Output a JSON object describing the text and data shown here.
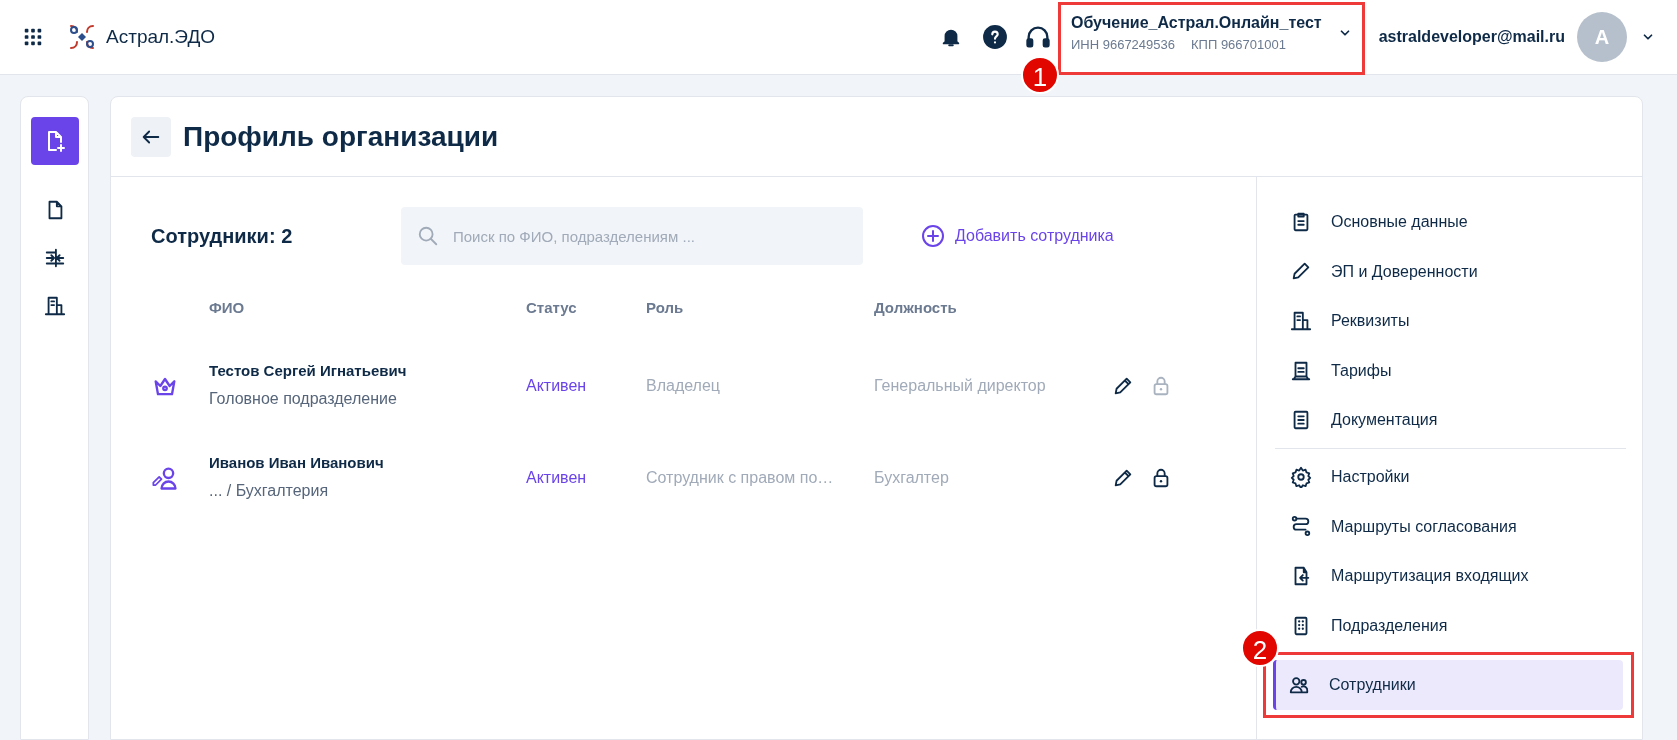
{
  "header": {
    "app_name": "Астрал.ЭДО",
    "organization": {
      "name": "Обучение_Астрал.Онлайн_тест",
      "inn": "ИНН 9667249536",
      "kpp": "КПП 966701001",
      "callout": "1"
    },
    "user": {
      "email": "astraldeveloper@mail.ru",
      "avatar_letter": "A"
    }
  },
  "page": {
    "title": "Профиль организации"
  },
  "employees": {
    "count_label": "Сотрудники: 2",
    "search": {
      "placeholder": "Поиск по ФИО, подразделениям ..."
    },
    "add_button": "Добавить сотрудника",
    "columns": [
      "ФИО",
      "Статус",
      "Роль",
      "Должность"
    ],
    "rows": [
      {
        "kind": "owner",
        "name": "Тестов Сергей Игнатьевич",
        "department": "Головное подразделение",
        "status": "Активен",
        "role": "Владелец",
        "position": "Генеральный директор",
        "lock_disabled": true
      },
      {
        "kind": "signer",
        "name": "Иванов Иван Иванович",
        "department": "... / Бухгалтерия",
        "status": "Активен",
        "role": "Сотрудник с правом по…",
        "position": "Бухгалтер",
        "lock_disabled": false
      }
    ]
  },
  "nav": {
    "sections": [
      [
        {
          "label": "Основные данные",
          "selected": false
        },
        {
          "label": "ЭП и Доверенности",
          "selected": false
        },
        {
          "label": "Реквизиты",
          "selected": false
        },
        {
          "label": "Тарифы",
          "selected": false
        },
        {
          "label": "Документация",
          "selected": false
        }
      ],
      [
        {
          "label": "Настройки",
          "selected": false
        },
        {
          "label": "Маршруты согласования",
          "selected": false
        },
        {
          "label": "Маршрутизация входящих",
          "selected": false
        },
        {
          "label": "Подразделения",
          "selected": false
        },
        {
          "label": "Сотрудники",
          "selected": true,
          "callout": "2"
        }
      ]
    ]
  }
}
